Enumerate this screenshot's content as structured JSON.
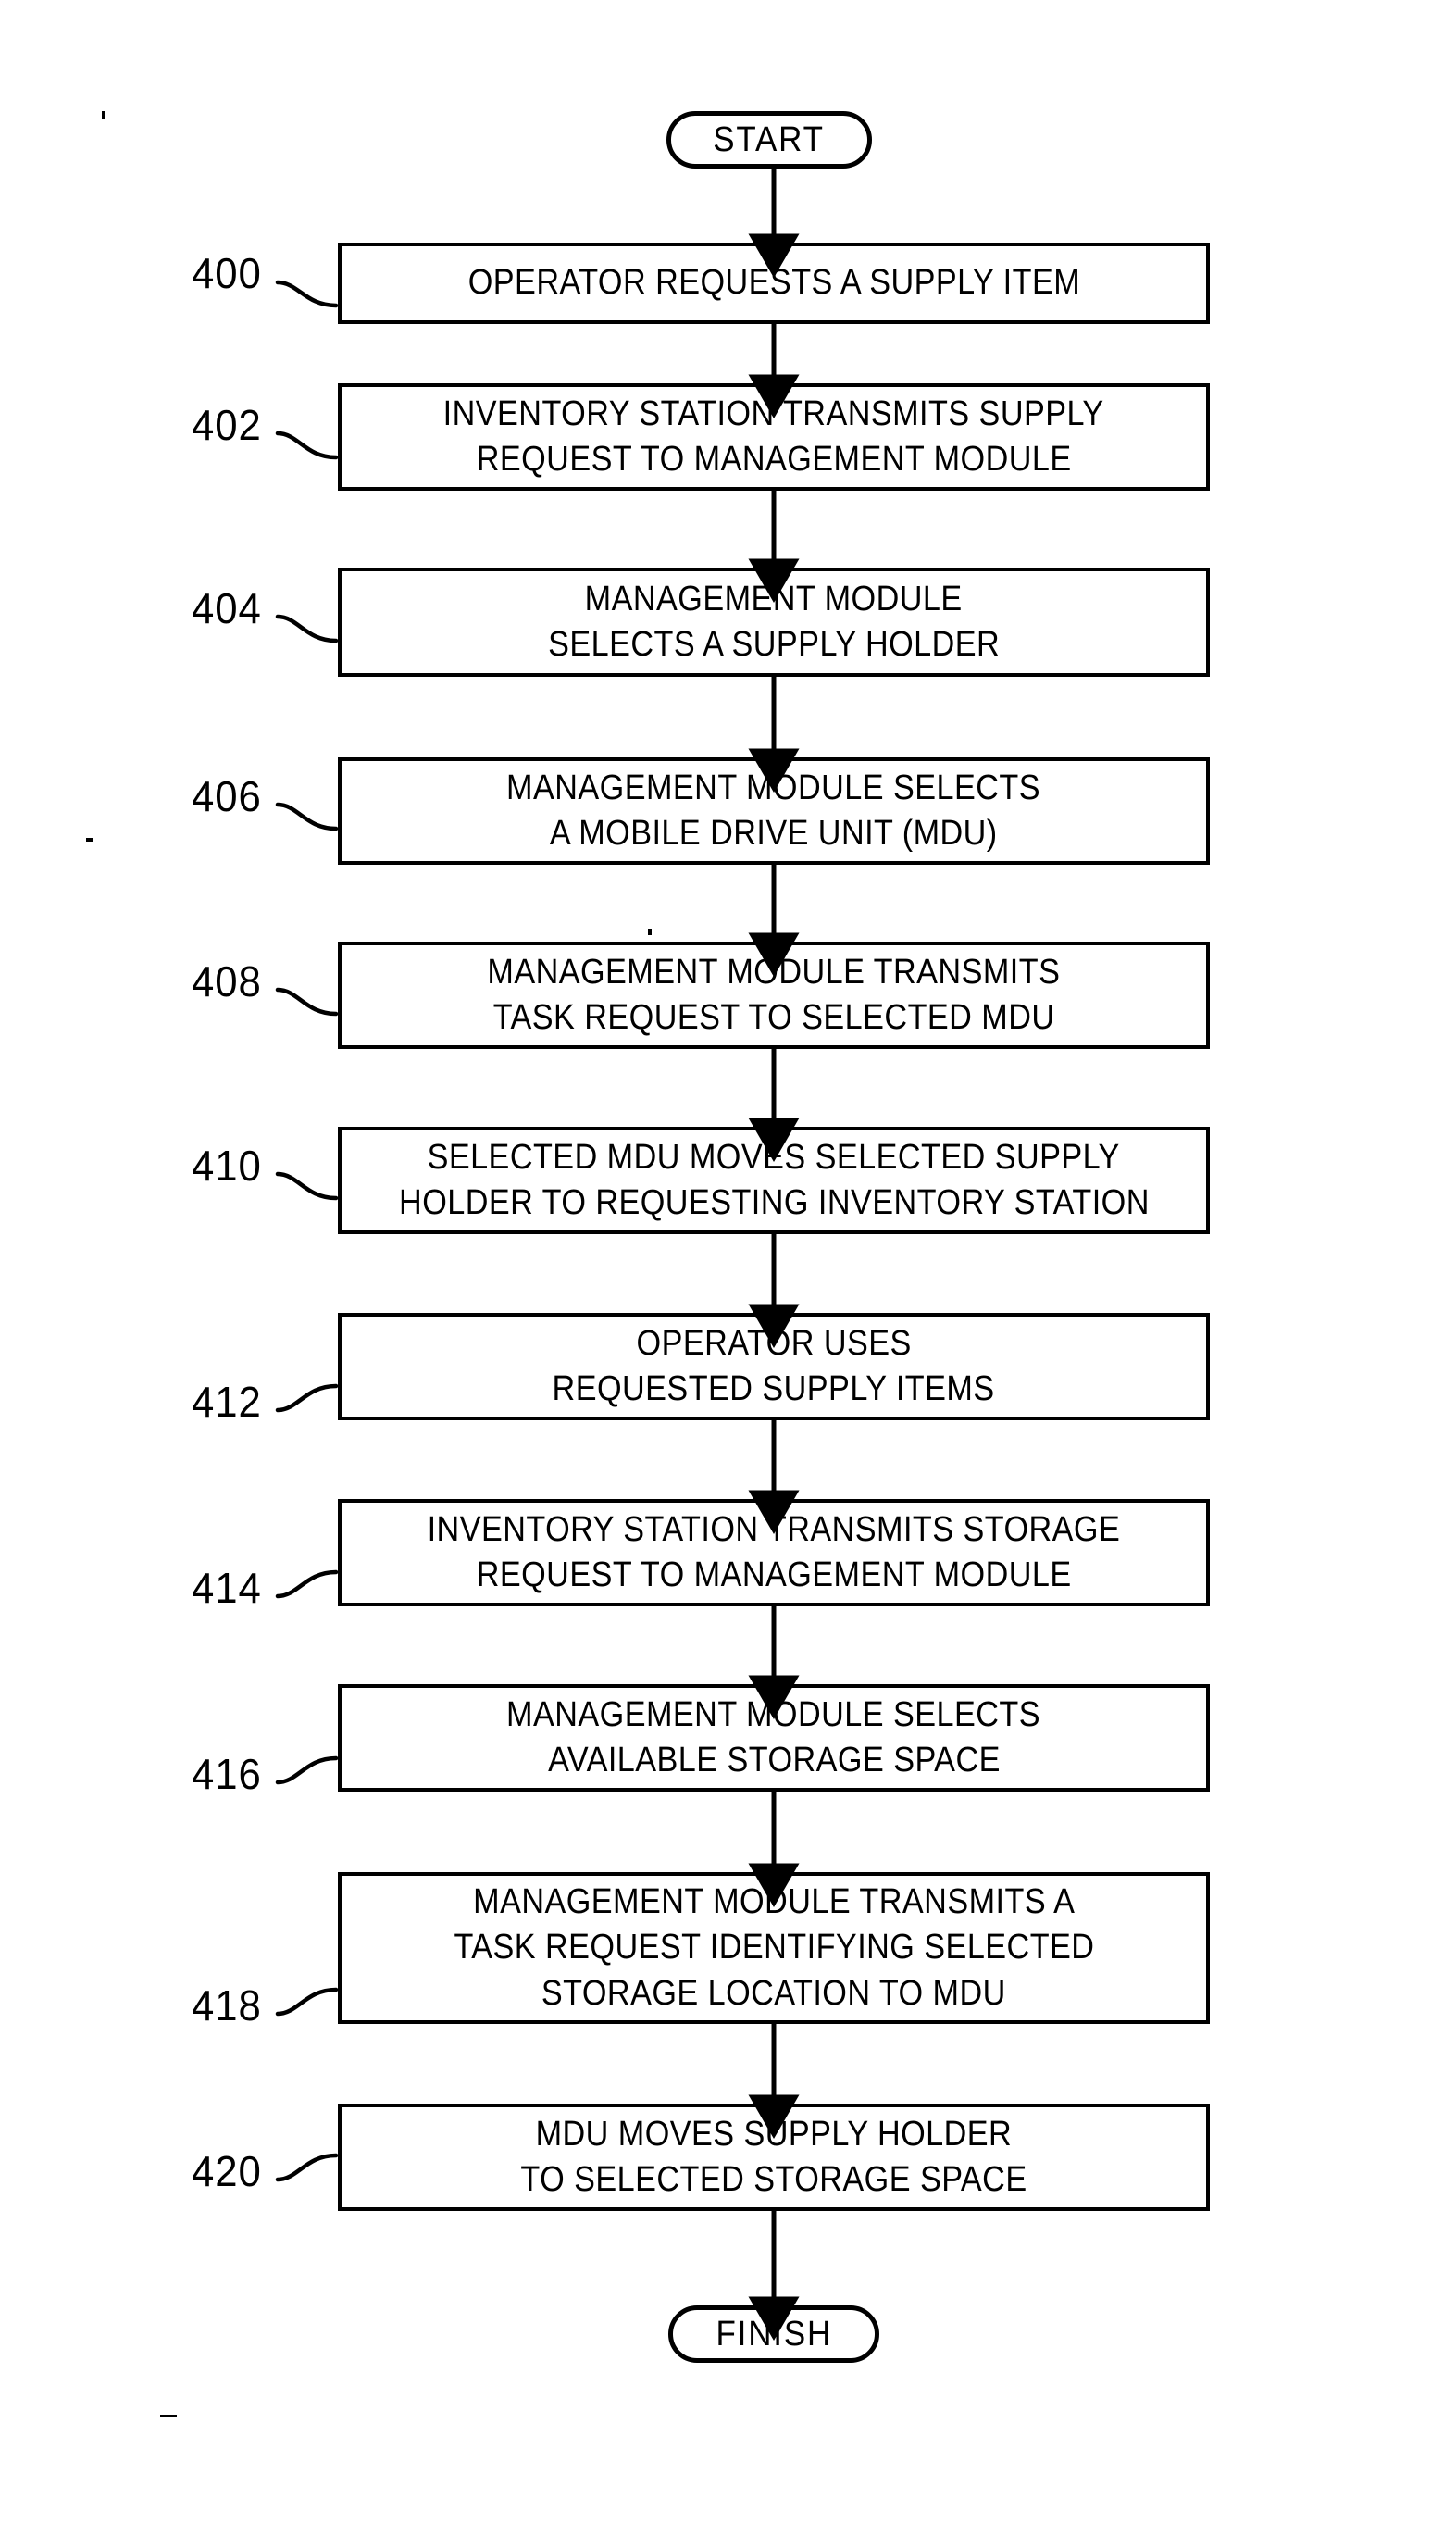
{
  "figure": {
    "kind": "patent-flowchart",
    "orientation": "vertical",
    "ink_color": "#000000",
    "background_color": "#ffffff"
  },
  "start_terminal": {
    "label": "START",
    "shape": "stadium"
  },
  "finish_terminal": {
    "label": "FINISH",
    "shape": "stadium"
  },
  "steps": [
    {
      "ref": "400",
      "lines": [
        "OPERATOR REQUESTS A SUPPLY ITEM"
      ],
      "leader": "down"
    },
    {
      "ref": "402",
      "lines": [
        "INVENTORY STATION TRANSMITS SUPPLY",
        "REQUEST TO MANAGEMENT MODULE"
      ],
      "leader": "down"
    },
    {
      "ref": "404",
      "lines": [
        "MANAGEMENT MODULE",
        "SELECTS A SUPPLY HOLDER"
      ],
      "leader": "down"
    },
    {
      "ref": "406",
      "lines": [
        "MANAGEMENT MODULE SELECTS",
        "A MOBILE DRIVE UNIT (MDU)"
      ],
      "leader": "down"
    },
    {
      "ref": "408",
      "lines": [
        "MANAGEMENT MODULE TRANSMITS",
        "TASK REQUEST TO SELECTED MDU"
      ],
      "leader": "down"
    },
    {
      "ref": "410",
      "lines": [
        "SELECTED MDU MOVES SELECTED SUPPLY",
        "HOLDER TO REQUESTING INVENTORY STATION"
      ],
      "leader": "down"
    },
    {
      "ref": "412",
      "lines": [
        "OPERATOR USES",
        "REQUESTED SUPPLY ITEMS"
      ],
      "leader": "up"
    },
    {
      "ref": "414",
      "lines": [
        "INVENTORY STATION TRANSMITS STORAGE",
        "REQUEST TO MANAGEMENT MODULE"
      ],
      "leader": "up"
    },
    {
      "ref": "416",
      "lines": [
        "MANAGEMENT MODULE SELECTS",
        "AVAILABLE STORAGE SPACE"
      ],
      "leader": "up"
    },
    {
      "ref": "418",
      "lines": [
        "MANAGEMENT MODULE TRANSMITS A",
        "TASK REQUEST IDENTIFYING SELECTED",
        "STORAGE LOCATION TO MDU"
      ],
      "leader": "up"
    },
    {
      "ref": "420",
      "lines": [
        "MDU MOVES SUPPLY HOLDER",
        "TO SELECTED STORAGE SPACE"
      ],
      "leader": "up"
    }
  ]
}
